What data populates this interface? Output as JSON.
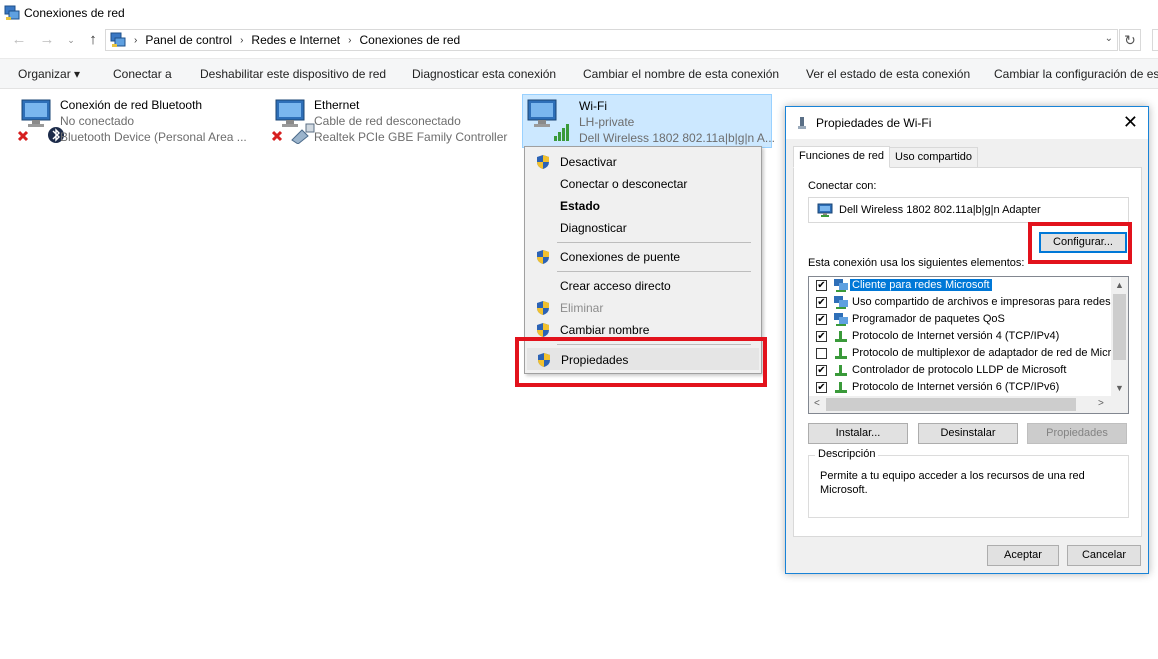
{
  "window": {
    "title": "Conexiones de red"
  },
  "address": {
    "crumbs": [
      "Panel de control",
      "Redes e Internet",
      "Conexiones de red"
    ],
    "back_glyph": "←",
    "forward_glyph": "→",
    "recent_glyph": "⌄",
    "up_glyph": "↑",
    "refresh_glyph": "↻",
    "dropdown_glyph": "⌄",
    "sep_glyph": "›"
  },
  "commandbar": {
    "organize": "Organizar ▾",
    "connect": "Conectar a",
    "disable": "Deshabilitar este dispositivo de red",
    "diagnose": "Diagnosticar esta conexión",
    "rename": "Cambiar el nombre de esta conexión",
    "status": "Ver el estado de esta conexión",
    "change_settings": "Cambiar la configuración de es"
  },
  "connections": [
    {
      "name": "Conexión de red Bluetooth",
      "status": "No conectado",
      "device": "Bluetooth Device (Personal Area ...",
      "icon": "bluetooth-adapter-icon"
    },
    {
      "name": "Ethernet",
      "status": "Cable de red desconectado",
      "device": "Realtek PCIe GBE Family Controller",
      "icon": "ethernet-adapter-icon"
    },
    {
      "name": "Wi-Fi",
      "status": "LH-private",
      "device": "Dell Wireless 1802 802.11a|b|g|n A...",
      "icon": "wifi-adapter-icon"
    }
  ],
  "context_menu": {
    "items": [
      {
        "label": "Desactivar",
        "shield": true
      },
      {
        "label": "Conectar o desconectar",
        "shield": false
      },
      {
        "label": "Estado",
        "shield": false,
        "bold": true
      },
      {
        "label": "Diagnosticar",
        "shield": false
      },
      {
        "label": "Conexiones de puente",
        "shield": true
      },
      {
        "label": "Crear acceso directo",
        "shield": false
      },
      {
        "label": "Eliminar",
        "shield": true,
        "disabled": true
      },
      {
        "label": "Cambiar nombre",
        "shield": true
      },
      {
        "label": "Propiedades",
        "shield": true,
        "hover": true
      }
    ]
  },
  "dialog": {
    "title": "Propiedades de Wi-Fi",
    "close_glyph": "✕",
    "tabs": [
      "Funciones de red",
      "Uso compartido"
    ],
    "connect_with_label": "Conectar con:",
    "adapter_name": "Dell Wireless 1802 802.11a|b|g|n Adapter",
    "configure_button": "Configurar...",
    "elements_label": "Esta conexión usa los siguientes elementos:",
    "elements": [
      {
        "label": "Cliente para redes Microsoft",
        "checked": true,
        "selected": true,
        "icon": "network-client-icon"
      },
      {
        "label": "Uso compartido de archivos e impresoras para redes M",
        "checked": true,
        "icon": "network-service-icon"
      },
      {
        "label": "Programador de paquetes QoS",
        "checked": true,
        "icon": "network-service-icon"
      },
      {
        "label": "Protocolo de Internet versión 4 (TCP/IPv4)",
        "checked": true,
        "icon": "protocol-icon"
      },
      {
        "label": "Protocolo de multiplexor de adaptador de red de Micros",
        "checked": false,
        "icon": "protocol-icon"
      },
      {
        "label": "Controlador de protocolo LLDP de Microsoft",
        "checked": true,
        "icon": "protocol-icon"
      },
      {
        "label": "Protocolo de Internet versión 6 (TCP/IPv6)",
        "checked": true,
        "icon": "protocol-icon"
      }
    ],
    "install_button": "Instalar...",
    "uninstall_button": "Desinstalar",
    "properties_button": "Propiedades",
    "description_title": "Descripción",
    "description_text": "Permite a tu equipo acceder a los recursos de una red Microsoft.",
    "ok_button": "Aceptar",
    "cancel_button": "Cancelar",
    "check_glyph": "✔",
    "scroll_up_glyph": "▲",
    "scroll_down_glyph": "▼",
    "scroll_left_glyph": "<",
    "scroll_right_glyph": ">"
  },
  "colors": {
    "highlight": "#e2121c",
    "selection": "#cce8ff",
    "accent": "#0078d7"
  }
}
